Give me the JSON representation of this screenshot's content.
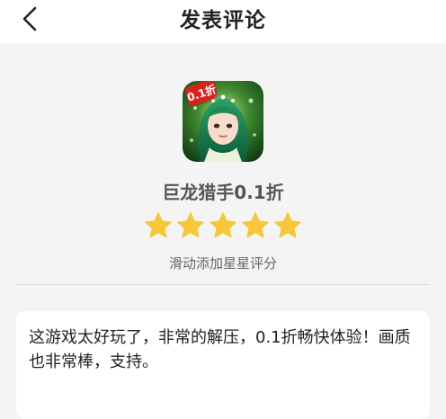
{
  "header": {
    "title": "发表评论",
    "back_icon": "chevron-left-icon"
  },
  "game": {
    "name": "巨龙猎手0.1折",
    "discount_badge": "0.1折",
    "icon": "game-app-icon"
  },
  "rating": {
    "stars_filled": 5,
    "stars_total": 5,
    "star_color": "#f7c739",
    "hint": "滑动添加星星评分"
  },
  "comment": {
    "text": "这游戏太好玩了，非常的解压，0.1折畅快体验！画质也非常棒，支持。"
  },
  "colors": {
    "background": "#f4f4f4",
    "header_bg": "#ffffff",
    "badge_red": "#d9211e"
  }
}
